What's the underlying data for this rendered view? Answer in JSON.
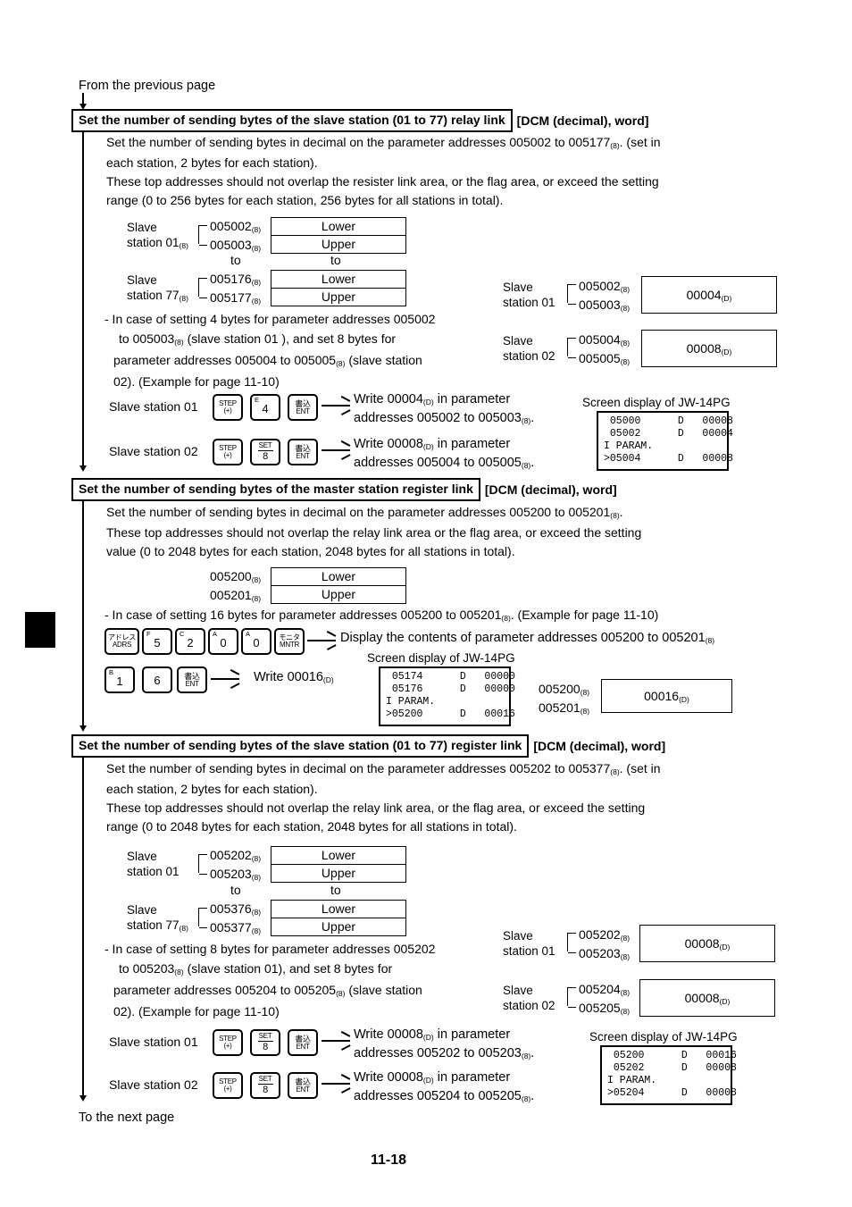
{
  "page": {
    "from_previous": "From the previous page",
    "to_next": "To the next page",
    "number": "11-18"
  },
  "sections": [
    {
      "id": "slave-relay-link",
      "heading": "Set the number of sending bytes of the slave station (01 to 77) relay link",
      "heading_tail": "[DCM (decimal), word]",
      "paragraphs": [
        "Set the number of sending bytes in decimal on the parameter addresses 005002 to 005177(8). (set in",
        "each station, 2 bytes for each station).",
        "These top addresses should not overlap the resister link area, or the flag area, or exceed the setting",
        "range (0 to 256 bytes for each station, 256 bytes for all stations in total)."
      ],
      "map": {
        "first": {
          "station_line1": "Slave",
          "station_line2": "station 01",
          "station_sub": "(8)",
          "addr_lower": "005002",
          "addr_upper": "005003",
          "addr_sub": "(8)",
          "cell_lower": "Lower",
          "cell_upper": "Upper"
        },
        "to_label": "to",
        "last": {
          "station_line1": "Slave",
          "station_line2": "station 77",
          "station_sub": "(8)",
          "addr_lower": "005176",
          "addr_upper": "005177",
          "addr_sub": "(8)",
          "cell_lower": "Lower",
          "cell_upper": "Upper"
        }
      },
      "example_text": [
        "- In case of setting 4 bytes for parameter addresses  005002",
        "to  005003(8) (slave station  01 ), and set 8 bytes for",
        "parameter addresses 005004 to 005005(8) (slave station",
        "02). (Example for page 11-10)"
      ],
      "result_boxes": [
        {
          "station_line1": "Slave",
          "station_line2": "station 01",
          "addr_top": "005002",
          "addr_bottom": "005003",
          "addr_sub": "(8)",
          "value": "00004",
          "value_sub": "(D)"
        },
        {
          "station_line1": "Slave",
          "station_line2": "station 02",
          "addr_top": "005004",
          "addr_bottom": "005005",
          "addr_sub": "(8)",
          "value": "00008",
          "value_sub": "(D)"
        }
      ],
      "key_sequences": [
        {
          "station": "Slave station 01",
          "keys": [
            {
              "type": "two-line",
              "top": "STEP",
              "bottom": "(+)"
            },
            {
              "type": "corner-digit",
              "corner": "E",
              "digit": "4"
            },
            {
              "type": "two-line",
              "top": "書込",
              "bottom": "ENT"
            }
          ],
          "desc_line1": "Write  00004(D)  in  parameter",
          "desc_line2": "addresses 005002 to 005003(8)."
        },
        {
          "station": "Slave station 02",
          "keys": [
            {
              "type": "two-line",
              "top": "STEP",
              "bottom": "(+)"
            },
            {
              "type": "set-digit",
              "top": "SET",
              "digit": "8"
            },
            {
              "type": "two-line",
              "top": "書込",
              "bottom": "ENT"
            }
          ],
          "desc_line1": "Write  00008(D)  in  parameter",
          "desc_line2": "addresses 005004 to 005005(8)."
        }
      ],
      "screen": {
        "caption": "Screen display of JW-14PG",
        "lines": " 05000      D   00008\n 05002      D   00004\nI PARAM.\n>05004      D   00008"
      }
    },
    {
      "id": "master-register-link",
      "heading": "Set the number of sending bytes of the master station register link",
      "heading_tail": "[DCM (decimal), word]",
      "paragraphs": [
        "Set the number of sending bytes in decimal on the parameter addresses 005200 to 005201(8).",
        "These top addresses should not overlap the relay link area or the flag area, or exceed the setting",
        "value (0 to 2048 bytes for each station, 2048 bytes for all stations in total)."
      ],
      "map": {
        "addr_lower": "005200",
        "addr_upper": "005201",
        "addr_sub": "(8)",
        "cell_lower": "Lower",
        "cell_upper": "Upper"
      },
      "example_text": "- In case of setting 16 bytes for parameter addresses 005200 to 005201(8). (Example for page 11-10)",
      "key_sequences": [
        {
          "keys": [
            {
              "type": "jp-two-line",
              "top": "アドレス",
              "bottom": "ADRS"
            },
            {
              "type": "corner-digit",
              "corner": "F",
              "digit": "5"
            },
            {
              "type": "corner-digit",
              "corner": "C",
              "digit": "2"
            },
            {
              "type": "corner-digit",
              "corner": "A",
              "digit": "0"
            },
            {
              "type": "corner-digit",
              "corner": "A",
              "digit": "0"
            },
            {
              "type": "jp-two-line",
              "top": "モニタ",
              "bottom": "MNTR"
            }
          ],
          "desc": "Display the contents of parameter addresses 005200 to 005201(8)"
        },
        {
          "keys": [
            {
              "type": "corner-digit",
              "corner": "B",
              "digit": "1"
            },
            {
              "type": "plain-digit",
              "digit": "6"
            },
            {
              "type": "two-line",
              "top": "書込",
              "bottom": "ENT"
            }
          ],
          "desc": "Write 00016(D)"
        }
      ],
      "screen": {
        "caption": "Screen display of JW-14PG",
        "lines": " 05174      D   00000\n 05176      D   00000\nI PARAM.\n>05200      D   00016"
      },
      "result_box": {
        "addr_top": "005200",
        "addr_bottom": "005201",
        "addr_sub": "(8)",
        "value": "00016",
        "value_sub": "(D)"
      }
    },
    {
      "id": "slave-register-link",
      "heading": "Set the number of sending bytes of the slave station (01 to 77) register link",
      "heading_tail": "[DCM (decimal), word]",
      "paragraphs": [
        "Set the number of sending bytes in decimal on the parameter addresses 005202 to 005377(8). (set in",
        "each station, 2 bytes for each station).",
        "These top addresses should not overlap the relay link area, or the flag area, or exceed the setting",
        "range (0 to 2048 bytes for each station, 2048 bytes for all stations in total)."
      ],
      "map": {
        "first": {
          "station_line1": "Slave",
          "station_line2": "station 01",
          "station_sub": "",
          "addr_lower": "005202",
          "addr_upper": "005203",
          "addr_sub": "(8)",
          "cell_lower": "Lower",
          "cell_upper": "Upper"
        },
        "to_label": "to",
        "last": {
          "station_line1": "Slave",
          "station_line2": "station 77",
          "station_sub": "(8)",
          "addr_lower": "005376",
          "addr_upper": "005377",
          "addr_sub": "(8)",
          "cell_lower": "Lower",
          "cell_upper": "Upper"
        }
      },
      "example_text": [
        "- In case of setting 8 bytes for parameter addresses 005202",
        "to  005203(8)  (slave  station  01),  and  set  8  bytes  for",
        "parameter addresses 005204 to 005205(8) (slave station",
        "02). (Example for page 11-10)"
      ],
      "result_boxes": [
        {
          "station_line1": "Slave",
          "station_line2": "station 01",
          "addr_top": "005202",
          "addr_bottom": "005203",
          "addr_sub": "(8)",
          "value": "00008",
          "value_sub": "(D)"
        },
        {
          "station_line1": "Slave",
          "station_line2": "station 02",
          "addr_top": "005204",
          "addr_bottom": "005205",
          "addr_sub": "(8)",
          "value": "00008",
          "value_sub": "(D)"
        }
      ],
      "key_sequences": [
        {
          "station": "Slave station 01",
          "keys": [
            {
              "type": "two-line",
              "top": "STEP",
              "bottom": "(+)"
            },
            {
              "type": "set-digit",
              "top": "SET",
              "digit": "8"
            },
            {
              "type": "two-line",
              "top": "書込",
              "bottom": "ENT"
            }
          ],
          "desc_line1": "Write 00008(D) in parameter",
          "desc_line2": "addresses 005202 to 005203(8)."
        },
        {
          "station": "Slave station 02",
          "keys": [
            {
              "type": "two-line",
              "top": "STEP",
              "bottom": "(+)"
            },
            {
              "type": "set-digit",
              "top": "SET",
              "digit": "8"
            },
            {
              "type": "two-line",
              "top": "書込",
              "bottom": "ENT"
            }
          ],
          "desc_line1": "Write 00008(D) in parameter",
          "desc_line2": "addresses 005204 to 005205(8)."
        }
      ],
      "screen": {
        "caption": "Screen display of JW-14PG",
        "lines": " 05200      D   00016\n 05202      D   00008\nI PARAM.\n>05204      D   00008"
      }
    }
  ]
}
